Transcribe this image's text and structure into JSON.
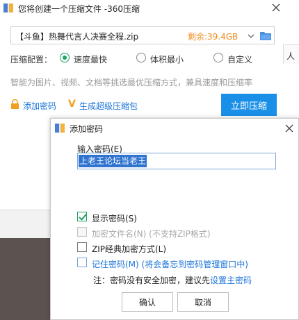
{
  "compress_dialog": {
    "title": "您将创建一个压缩文件 -360压缩",
    "file_name": "【斗鱼】热舞代言人决赛全程.zip",
    "remaining": "剩余:39.4GB",
    "config_label": "压缩配置：",
    "options": [
      {
        "label": "速度最快",
        "checked": true
      },
      {
        "label": "体积最小",
        "checked": false
      },
      {
        "label": "自定义",
        "checked": false
      }
    ],
    "hint": "智能为图片、视频、文档等挑选最优压缩方式，兼具速度和压缩率",
    "add_password_link": "添加密码",
    "super_package_link": "生成超级压缩包",
    "compress_button": "立即压缩",
    "right_edge_text": "人"
  },
  "password_dialog": {
    "title": "添加密码",
    "input_label": "输入密码(E)",
    "password_value": "上老王论坛当老王",
    "checkboxes": [
      {
        "label": "显示密码(S)",
        "checked": true,
        "disabled": false
      },
      {
        "label": "加密文件名(N)  (不支持ZIP格式)",
        "checked": false,
        "disabled": true
      },
      {
        "label": "ZIP经典加密方式(L)",
        "checked": false,
        "disabled": false
      },
      {
        "label": "记住密码(M) (将会备忘到密码管理窗口中)",
        "checked": false,
        "disabled": false
      }
    ],
    "note_prefix": "注：密码没有安全加密，建议先",
    "note_link": "设置主密码",
    "ok_button": "确认",
    "cancel_button": "取消"
  },
  "colors": {
    "accent_blue": "#1a8fe8",
    "link_blue": "#1a73d9",
    "radio_green": "#1aa260",
    "remaining_orange": "#f08a17"
  }
}
